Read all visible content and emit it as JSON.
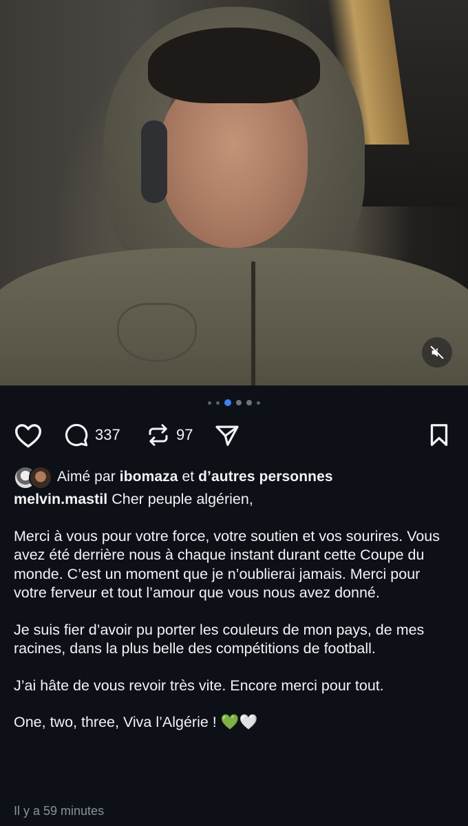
{
  "post": {
    "media": {
      "carousel_count": 6,
      "active_index": 2,
      "mute_icon": "speaker-muted-icon"
    },
    "actions": {
      "like_icon": "heart-icon",
      "comment_icon": "comment-bubble-icon",
      "comment_count": "337",
      "repost_icon": "repost-icon",
      "repost_count": "97",
      "share_icon": "send-icon",
      "save_icon": "bookmark-icon"
    },
    "liked_by": {
      "prefix": "Aimé par",
      "user": "ibomaza",
      "connector": "et",
      "others": "d’autres personnes"
    },
    "caption": {
      "username": "melvin.mastil",
      "first_line": "Cher peuple algérien,",
      "paragraphs": [
        "Merci à vous pour votre force, votre soutien et vos sourires. Vous avez été derrière nous à chaque instant durant cette Coupe du monde. C’est un moment que je n’oublierai jamais. Merci pour votre ferveur et tout l’amour que vous nous avez donné.",
        "Je suis fier d’avoir pu porter les couleurs de mon pays, de mes racines, dans la plus belle des compétitions de football.",
        "J’ai hâte de vous revoir très vite. Encore merci pour tout.",
        "One, two, three, Viva l’Algérie ! 💚🤍"
      ]
    },
    "timestamp": "Il y a 59 minutes"
  }
}
